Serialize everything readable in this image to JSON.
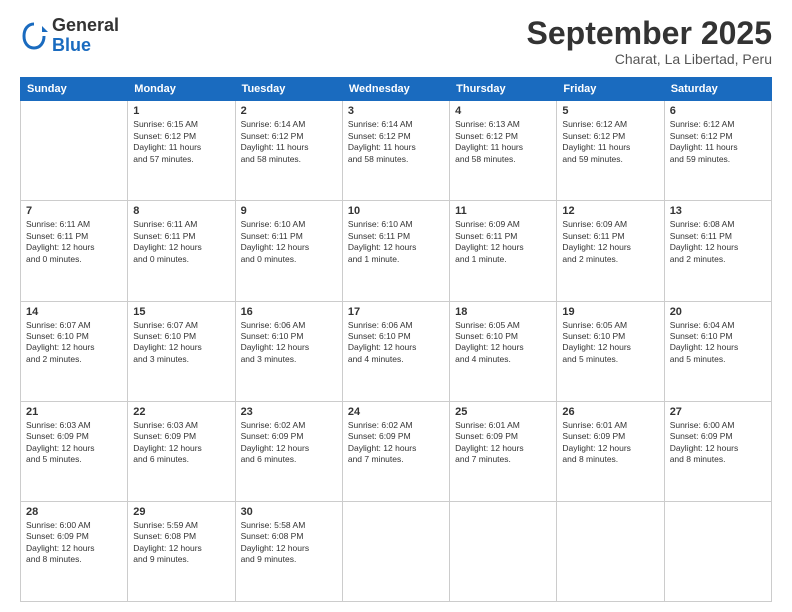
{
  "logo": {
    "general": "General",
    "blue": "Blue"
  },
  "title": "September 2025",
  "subtitle": "Charat, La Libertad, Peru",
  "days": [
    "Sunday",
    "Monday",
    "Tuesday",
    "Wednesday",
    "Thursday",
    "Friday",
    "Saturday"
  ],
  "weeks": [
    [
      {
        "num": "",
        "info": ""
      },
      {
        "num": "1",
        "info": "Sunrise: 6:15 AM\nSunset: 6:12 PM\nDaylight: 11 hours\nand 57 minutes."
      },
      {
        "num": "2",
        "info": "Sunrise: 6:14 AM\nSunset: 6:12 PM\nDaylight: 11 hours\nand 58 minutes."
      },
      {
        "num": "3",
        "info": "Sunrise: 6:14 AM\nSunset: 6:12 PM\nDaylight: 11 hours\nand 58 minutes."
      },
      {
        "num": "4",
        "info": "Sunrise: 6:13 AM\nSunset: 6:12 PM\nDaylight: 11 hours\nand 58 minutes."
      },
      {
        "num": "5",
        "info": "Sunrise: 6:12 AM\nSunset: 6:12 PM\nDaylight: 11 hours\nand 59 minutes."
      },
      {
        "num": "6",
        "info": "Sunrise: 6:12 AM\nSunset: 6:12 PM\nDaylight: 11 hours\nand 59 minutes."
      }
    ],
    [
      {
        "num": "7",
        "info": "Sunrise: 6:11 AM\nSunset: 6:11 PM\nDaylight: 12 hours\nand 0 minutes."
      },
      {
        "num": "8",
        "info": "Sunrise: 6:11 AM\nSunset: 6:11 PM\nDaylight: 12 hours\nand 0 minutes."
      },
      {
        "num": "9",
        "info": "Sunrise: 6:10 AM\nSunset: 6:11 PM\nDaylight: 12 hours\nand 0 minutes."
      },
      {
        "num": "10",
        "info": "Sunrise: 6:10 AM\nSunset: 6:11 PM\nDaylight: 12 hours\nand 1 minute."
      },
      {
        "num": "11",
        "info": "Sunrise: 6:09 AM\nSunset: 6:11 PM\nDaylight: 12 hours\nand 1 minute."
      },
      {
        "num": "12",
        "info": "Sunrise: 6:09 AM\nSunset: 6:11 PM\nDaylight: 12 hours\nand 2 minutes."
      },
      {
        "num": "13",
        "info": "Sunrise: 6:08 AM\nSunset: 6:11 PM\nDaylight: 12 hours\nand 2 minutes."
      }
    ],
    [
      {
        "num": "14",
        "info": "Sunrise: 6:07 AM\nSunset: 6:10 PM\nDaylight: 12 hours\nand 2 minutes."
      },
      {
        "num": "15",
        "info": "Sunrise: 6:07 AM\nSunset: 6:10 PM\nDaylight: 12 hours\nand 3 minutes."
      },
      {
        "num": "16",
        "info": "Sunrise: 6:06 AM\nSunset: 6:10 PM\nDaylight: 12 hours\nand 3 minutes."
      },
      {
        "num": "17",
        "info": "Sunrise: 6:06 AM\nSunset: 6:10 PM\nDaylight: 12 hours\nand 4 minutes."
      },
      {
        "num": "18",
        "info": "Sunrise: 6:05 AM\nSunset: 6:10 PM\nDaylight: 12 hours\nand 4 minutes."
      },
      {
        "num": "19",
        "info": "Sunrise: 6:05 AM\nSunset: 6:10 PM\nDaylight: 12 hours\nand 5 minutes."
      },
      {
        "num": "20",
        "info": "Sunrise: 6:04 AM\nSunset: 6:10 PM\nDaylight: 12 hours\nand 5 minutes."
      }
    ],
    [
      {
        "num": "21",
        "info": "Sunrise: 6:03 AM\nSunset: 6:09 PM\nDaylight: 12 hours\nand 5 minutes."
      },
      {
        "num": "22",
        "info": "Sunrise: 6:03 AM\nSunset: 6:09 PM\nDaylight: 12 hours\nand 6 minutes."
      },
      {
        "num": "23",
        "info": "Sunrise: 6:02 AM\nSunset: 6:09 PM\nDaylight: 12 hours\nand 6 minutes."
      },
      {
        "num": "24",
        "info": "Sunrise: 6:02 AM\nSunset: 6:09 PM\nDaylight: 12 hours\nand 7 minutes."
      },
      {
        "num": "25",
        "info": "Sunrise: 6:01 AM\nSunset: 6:09 PM\nDaylight: 12 hours\nand 7 minutes."
      },
      {
        "num": "26",
        "info": "Sunrise: 6:01 AM\nSunset: 6:09 PM\nDaylight: 12 hours\nand 8 minutes."
      },
      {
        "num": "27",
        "info": "Sunrise: 6:00 AM\nSunset: 6:09 PM\nDaylight: 12 hours\nand 8 minutes."
      }
    ],
    [
      {
        "num": "28",
        "info": "Sunrise: 6:00 AM\nSunset: 6:09 PM\nDaylight: 12 hours\nand 8 minutes."
      },
      {
        "num": "29",
        "info": "Sunrise: 5:59 AM\nSunset: 6:08 PM\nDaylight: 12 hours\nand 9 minutes."
      },
      {
        "num": "30",
        "info": "Sunrise: 5:58 AM\nSunset: 6:08 PM\nDaylight: 12 hours\nand 9 minutes."
      },
      {
        "num": "",
        "info": ""
      },
      {
        "num": "",
        "info": ""
      },
      {
        "num": "",
        "info": ""
      },
      {
        "num": "",
        "info": ""
      }
    ]
  ]
}
